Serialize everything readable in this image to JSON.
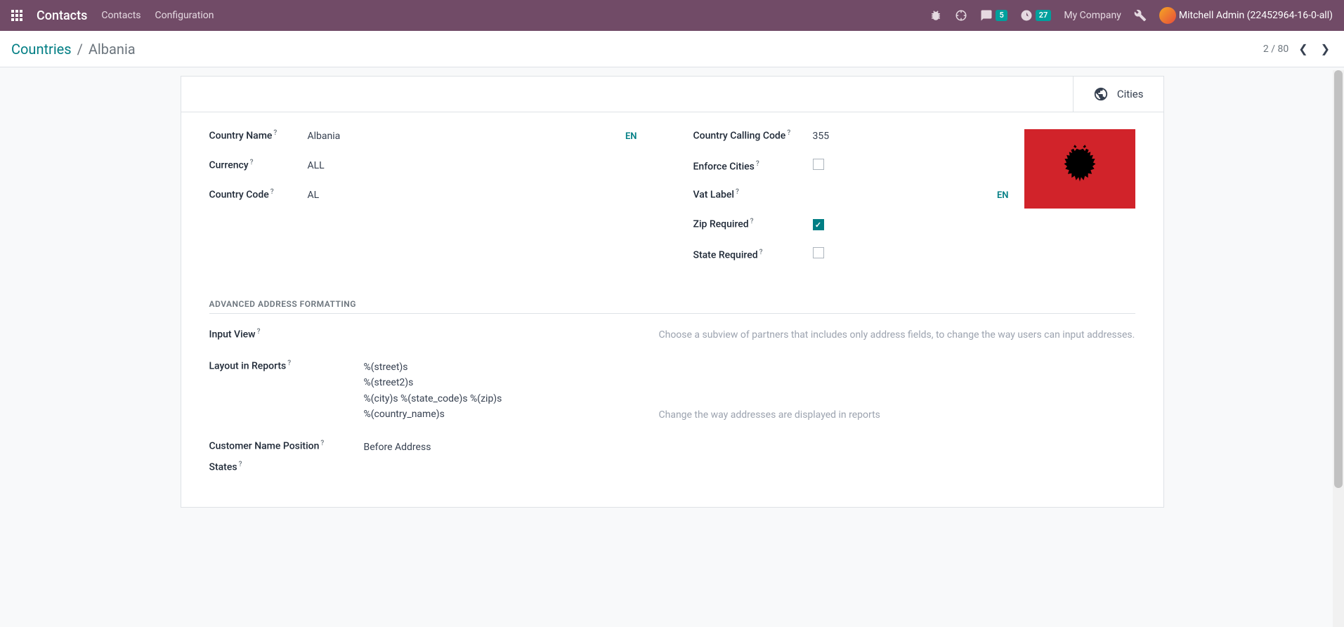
{
  "navbar": {
    "brand": "Contacts",
    "menu": [
      {
        "label": "Contacts"
      },
      {
        "label": "Configuration"
      }
    ],
    "discuss_badge": "5",
    "activity_badge": "27",
    "company": "My Company",
    "user": "Mitchell Admin (22452964-16-0-all)"
  },
  "breadcrumb": {
    "parent": "Countries",
    "current": "Albania"
  },
  "pager": {
    "text": "2 / 80"
  },
  "button_box": {
    "cities": "Cities"
  },
  "fields": {
    "country_name": {
      "label": "Country Name",
      "value": "Albania",
      "lang": "EN"
    },
    "currency": {
      "label": "Currency",
      "value": "ALL"
    },
    "country_code": {
      "label": "Country Code",
      "value": "AL"
    },
    "calling_code": {
      "label": "Country Calling Code",
      "value": "355"
    },
    "enforce_cities": {
      "label": "Enforce Cities"
    },
    "vat_label": {
      "label": "Vat Label",
      "value": "",
      "lang": "EN"
    },
    "zip_required": {
      "label": "Zip Required"
    },
    "state_required": {
      "label": "State Required"
    }
  },
  "section": {
    "title": "ADVANCED ADDRESS FORMATTING"
  },
  "advanced": {
    "input_view": {
      "label": "Input View",
      "help": "Choose a subview of partners that includes only address fields, to change the way users can input addresses."
    },
    "layout": {
      "label": "Layout in Reports",
      "value": "%(street)s\n%(street2)s\n%(city)s %(state_code)s %(zip)s\n%(country_name)s",
      "help": "Change the way addresses are displayed in reports"
    },
    "name_position": {
      "label": "Customer Name Position",
      "value": "Before Address"
    },
    "states": {
      "label": "States"
    }
  }
}
